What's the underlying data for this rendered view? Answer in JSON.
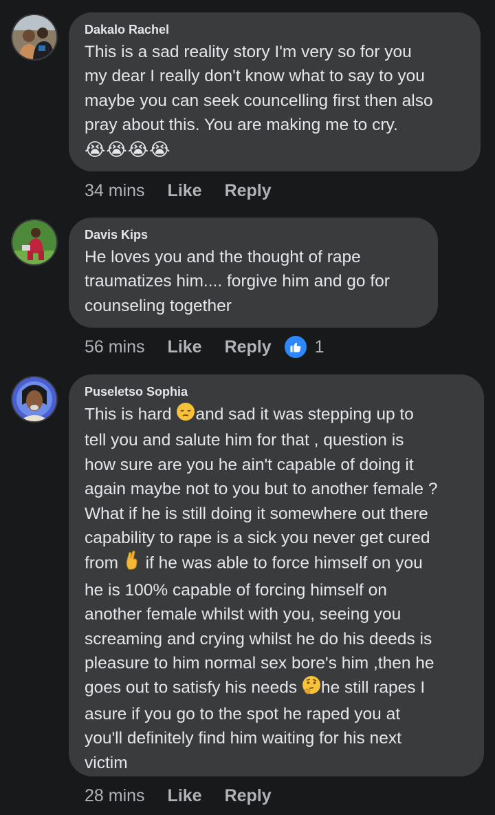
{
  "comments": [
    {
      "author": "Dakalo Rachel",
      "lines": [
        "This is a sad reality story I'm very so for you",
        "my dear I really don't know what to say to you",
        "maybe you can seek councelling first then also",
        "pray about this. You are making me to cry."
      ],
      "emoji_line": "😭😭😭😭",
      "time": "34 mins",
      "like_label": "Like",
      "reply_label": "Reply"
    },
    {
      "author": "Davis Kips",
      "lines": [
        "He loves you and the thought of rape",
        "traumatizes him.... forgive him and go for",
        "counseling together"
      ],
      "time": "56 mins",
      "like_label": "Like",
      "reply_label": "Reply",
      "reaction_count": "1",
      "reaction_icon": "like-thumb-icon"
    },
    {
      "author": "Puseletso Sophia",
      "lines": [
        "This is hard",
        "and sad it was stepping up to",
        "tell you and salute him for that , question is",
        "how sure are you he ain't capable of doing it",
        "again maybe not to you but to another female ?",
        "What if he is still doing it somewhere out there",
        "capability to rape is a sick you never get cured",
        "from",
        "if he was able to force himself on you",
        "he is 100% capable of forcing himself on",
        "another female whilst with you, seeing you",
        "screaming and crying whilst he do his deeds is",
        "pleasure to him normal sex bore's him ,then he",
        "goes out to satisfy his needs",
        "he still rapes I",
        "asure if you go to the spot he raped you at",
        "you'll definitely find him waiting for his next",
        "victim"
      ],
      "time": "28 mins",
      "like_label": "Like",
      "reply_label": "Reply"
    }
  ],
  "colors": {
    "background": "#18191a",
    "bubble": "#3a3b3c",
    "primary_text": "#e4e6eb",
    "secondary_text": "#b0b3b8",
    "like_blue": "#2d88ff"
  }
}
